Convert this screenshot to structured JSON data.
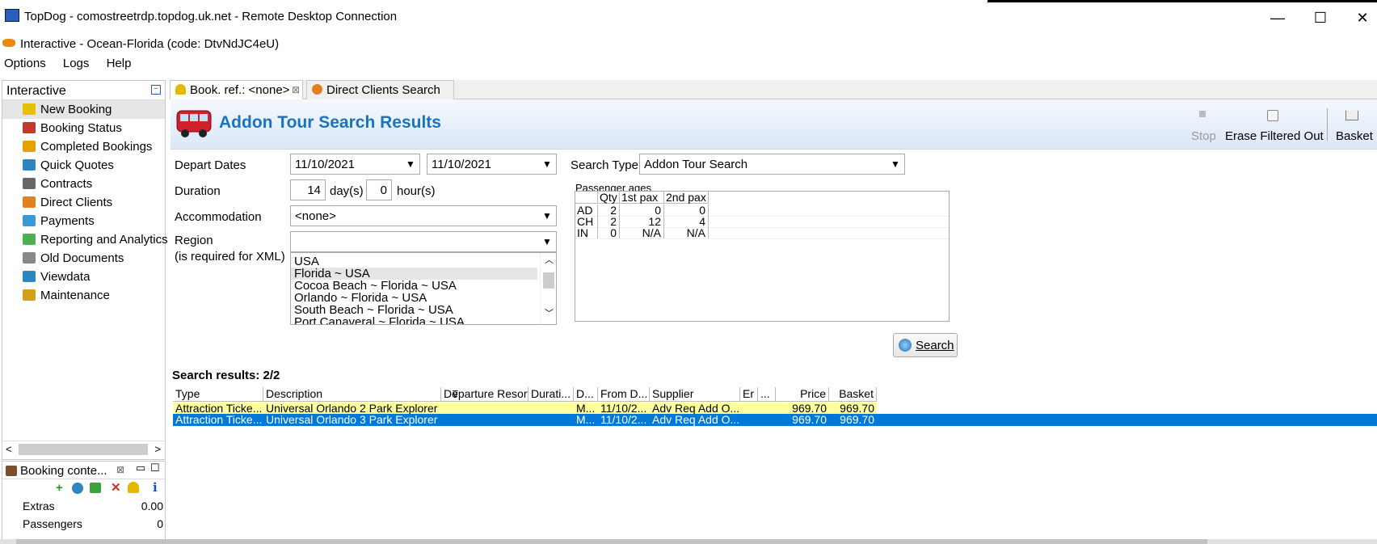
{
  "window": {
    "title": "TopDog - comostreetrdp.topdog.uk.net - Remote Desktop Connection",
    "minimize": "—",
    "maximize": "☐",
    "close": "✕"
  },
  "app": {
    "heading": "Interactive - Ocean-Florida (code: DtvNdJC4eU)"
  },
  "menu": [
    "Options",
    "Logs",
    "Help"
  ],
  "sidebar": {
    "title": "Interactive",
    "items": [
      {
        "label": "New Booking",
        "color": "#e5c100"
      },
      {
        "label": "Booking Status",
        "color": "#c0392b"
      },
      {
        "label": "Completed Bookings",
        "color": "#e5a100"
      },
      {
        "label": "Quick Quotes",
        "color": "#2e86c1"
      },
      {
        "label": "Contracts",
        "color": "#666666"
      },
      {
        "label": "Direct Clients",
        "color": "#e08020"
      },
      {
        "label": "Payments",
        "color": "#3a9ad9"
      },
      {
        "label": "Reporting and Analytics",
        "color": "#4caf50"
      },
      {
        "label": "Old Documents",
        "color": "#888888"
      },
      {
        "label": "Viewdata",
        "color": "#2e86c1"
      },
      {
        "label": "Maintenance",
        "color": "#d4a017"
      }
    ]
  },
  "booking_context": {
    "title": "Booking conte...",
    "rows": [
      {
        "label": "Extras",
        "value": "0.00"
      },
      {
        "label": "Passengers",
        "value": "0"
      }
    ]
  },
  "tabs": [
    {
      "label": "Book. ref.: <none>"
    },
    {
      "label": "Direct Clients Search"
    }
  ],
  "header": {
    "title": "Addon Tour Search Results",
    "stop": "Stop",
    "erase": "Erase Filtered Out",
    "basket": "Basket"
  },
  "form": {
    "depart_label": "Depart Dates",
    "depart_from": "11/10/2021",
    "depart_to": "11/10/2021",
    "duration_label": "Duration",
    "days": "14",
    "days_unit": "day(s)",
    "hours": "0",
    "hours_unit": "hour(s)",
    "accommodation_label": "Accommodation",
    "accommodation": "<none>",
    "region_label": "Region",
    "region_note": "(is required for XML)",
    "region_value": "",
    "region_list": [
      "USA",
      "Florida ~ USA",
      "Cocoa Beach ~ Florida ~ USA",
      "Orlando ~ Florida ~ USA",
      "South Beach ~ Florida ~ USA",
      "Port Canaveral ~ Florida ~ USA"
    ],
    "search_type_label": "Search Type",
    "search_type": "Addon Tour Search",
    "pax_label": "Passenger ages",
    "pax_headers": [
      "",
      "Qty",
      "1st pax",
      "2nd pax"
    ],
    "pax_rows": [
      {
        "type": "AD",
        "qty": "2",
        "p1": "0",
        "p2": "0"
      },
      {
        "type": "CH",
        "qty": "2",
        "p1": "12",
        "p2": "4"
      },
      {
        "type": "IN",
        "qty": "0",
        "p1": "N/A",
        "p2": "N/A"
      }
    ],
    "search_button": "Search"
  },
  "results": {
    "title": "Search results: 2/2",
    "headers": [
      "Type",
      "Description",
      "Departure Resort",
      "Durati...",
      "D...",
      "From D...",
      "Supplier",
      "Er",
      "...",
      "Price",
      "Basket"
    ],
    "rows": [
      {
        "type": "Attraction Ticke...",
        "desc": "Universal Orlando 2 Park Explorer ...",
        "resort": "",
        "dur": "",
        "d": "M...",
        "from": "11/10/2...",
        "supplier": "Adv Req Add O...",
        "er": "",
        "x": "",
        "price": "969.70",
        "basket": "969.70"
      },
      {
        "type": "Attraction Ticke...",
        "desc": "Universal Orlando 3 Park Explorer ...",
        "resort": "",
        "dur": "",
        "d": "M...",
        "from": "11/10/2...",
        "supplier": "Adv Req Add O...",
        "er": "",
        "x": "",
        "price": "969.70",
        "basket": "969.70"
      }
    ]
  },
  "colors": {
    "accent": "#1a73c2",
    "row_highlight": "#ffffa0",
    "row_selected": "#0078d7"
  }
}
